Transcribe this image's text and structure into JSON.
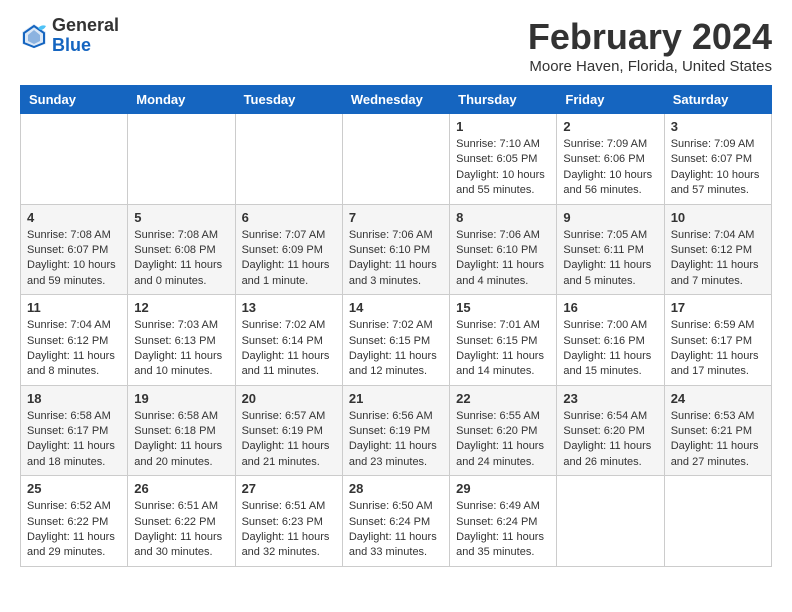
{
  "header": {
    "logo_line1": "General",
    "logo_line2": "Blue",
    "month": "February 2024",
    "location": "Moore Haven, Florida, United States"
  },
  "days_of_week": [
    "Sunday",
    "Monday",
    "Tuesday",
    "Wednesday",
    "Thursday",
    "Friday",
    "Saturday"
  ],
  "weeks": [
    [
      {
        "day": "",
        "info": ""
      },
      {
        "day": "",
        "info": ""
      },
      {
        "day": "",
        "info": ""
      },
      {
        "day": "",
        "info": ""
      },
      {
        "day": "1",
        "info": "Sunrise: 7:10 AM\nSunset: 6:05 PM\nDaylight: 10 hours\nand 55 minutes."
      },
      {
        "day": "2",
        "info": "Sunrise: 7:09 AM\nSunset: 6:06 PM\nDaylight: 10 hours\nand 56 minutes."
      },
      {
        "day": "3",
        "info": "Sunrise: 7:09 AM\nSunset: 6:07 PM\nDaylight: 10 hours\nand 57 minutes."
      }
    ],
    [
      {
        "day": "4",
        "info": "Sunrise: 7:08 AM\nSunset: 6:07 PM\nDaylight: 10 hours\nand 59 minutes."
      },
      {
        "day": "5",
        "info": "Sunrise: 7:08 AM\nSunset: 6:08 PM\nDaylight: 11 hours\nand 0 minutes."
      },
      {
        "day": "6",
        "info": "Sunrise: 7:07 AM\nSunset: 6:09 PM\nDaylight: 11 hours\nand 1 minute."
      },
      {
        "day": "7",
        "info": "Sunrise: 7:06 AM\nSunset: 6:10 PM\nDaylight: 11 hours\nand 3 minutes."
      },
      {
        "day": "8",
        "info": "Sunrise: 7:06 AM\nSunset: 6:10 PM\nDaylight: 11 hours\nand 4 minutes."
      },
      {
        "day": "9",
        "info": "Sunrise: 7:05 AM\nSunset: 6:11 PM\nDaylight: 11 hours\nand 5 minutes."
      },
      {
        "day": "10",
        "info": "Sunrise: 7:04 AM\nSunset: 6:12 PM\nDaylight: 11 hours\nand 7 minutes."
      }
    ],
    [
      {
        "day": "11",
        "info": "Sunrise: 7:04 AM\nSunset: 6:12 PM\nDaylight: 11 hours\nand 8 minutes."
      },
      {
        "day": "12",
        "info": "Sunrise: 7:03 AM\nSunset: 6:13 PM\nDaylight: 11 hours\nand 10 minutes."
      },
      {
        "day": "13",
        "info": "Sunrise: 7:02 AM\nSunset: 6:14 PM\nDaylight: 11 hours\nand 11 minutes."
      },
      {
        "day": "14",
        "info": "Sunrise: 7:02 AM\nSunset: 6:15 PM\nDaylight: 11 hours\nand 12 minutes."
      },
      {
        "day": "15",
        "info": "Sunrise: 7:01 AM\nSunset: 6:15 PM\nDaylight: 11 hours\nand 14 minutes."
      },
      {
        "day": "16",
        "info": "Sunrise: 7:00 AM\nSunset: 6:16 PM\nDaylight: 11 hours\nand 15 minutes."
      },
      {
        "day": "17",
        "info": "Sunrise: 6:59 AM\nSunset: 6:17 PM\nDaylight: 11 hours\nand 17 minutes."
      }
    ],
    [
      {
        "day": "18",
        "info": "Sunrise: 6:58 AM\nSunset: 6:17 PM\nDaylight: 11 hours\nand 18 minutes."
      },
      {
        "day": "19",
        "info": "Sunrise: 6:58 AM\nSunset: 6:18 PM\nDaylight: 11 hours\nand 20 minutes."
      },
      {
        "day": "20",
        "info": "Sunrise: 6:57 AM\nSunset: 6:19 PM\nDaylight: 11 hours\nand 21 minutes."
      },
      {
        "day": "21",
        "info": "Sunrise: 6:56 AM\nSunset: 6:19 PM\nDaylight: 11 hours\nand 23 minutes."
      },
      {
        "day": "22",
        "info": "Sunrise: 6:55 AM\nSunset: 6:20 PM\nDaylight: 11 hours\nand 24 minutes."
      },
      {
        "day": "23",
        "info": "Sunrise: 6:54 AM\nSunset: 6:20 PM\nDaylight: 11 hours\nand 26 minutes."
      },
      {
        "day": "24",
        "info": "Sunrise: 6:53 AM\nSunset: 6:21 PM\nDaylight: 11 hours\nand 27 minutes."
      }
    ],
    [
      {
        "day": "25",
        "info": "Sunrise: 6:52 AM\nSunset: 6:22 PM\nDaylight: 11 hours\nand 29 minutes."
      },
      {
        "day": "26",
        "info": "Sunrise: 6:51 AM\nSunset: 6:22 PM\nDaylight: 11 hours\nand 30 minutes."
      },
      {
        "day": "27",
        "info": "Sunrise: 6:51 AM\nSunset: 6:23 PM\nDaylight: 11 hours\nand 32 minutes."
      },
      {
        "day": "28",
        "info": "Sunrise: 6:50 AM\nSunset: 6:24 PM\nDaylight: 11 hours\nand 33 minutes."
      },
      {
        "day": "29",
        "info": "Sunrise: 6:49 AM\nSunset: 6:24 PM\nDaylight: 11 hours\nand 35 minutes."
      },
      {
        "day": "",
        "info": ""
      },
      {
        "day": "",
        "info": ""
      }
    ]
  ]
}
